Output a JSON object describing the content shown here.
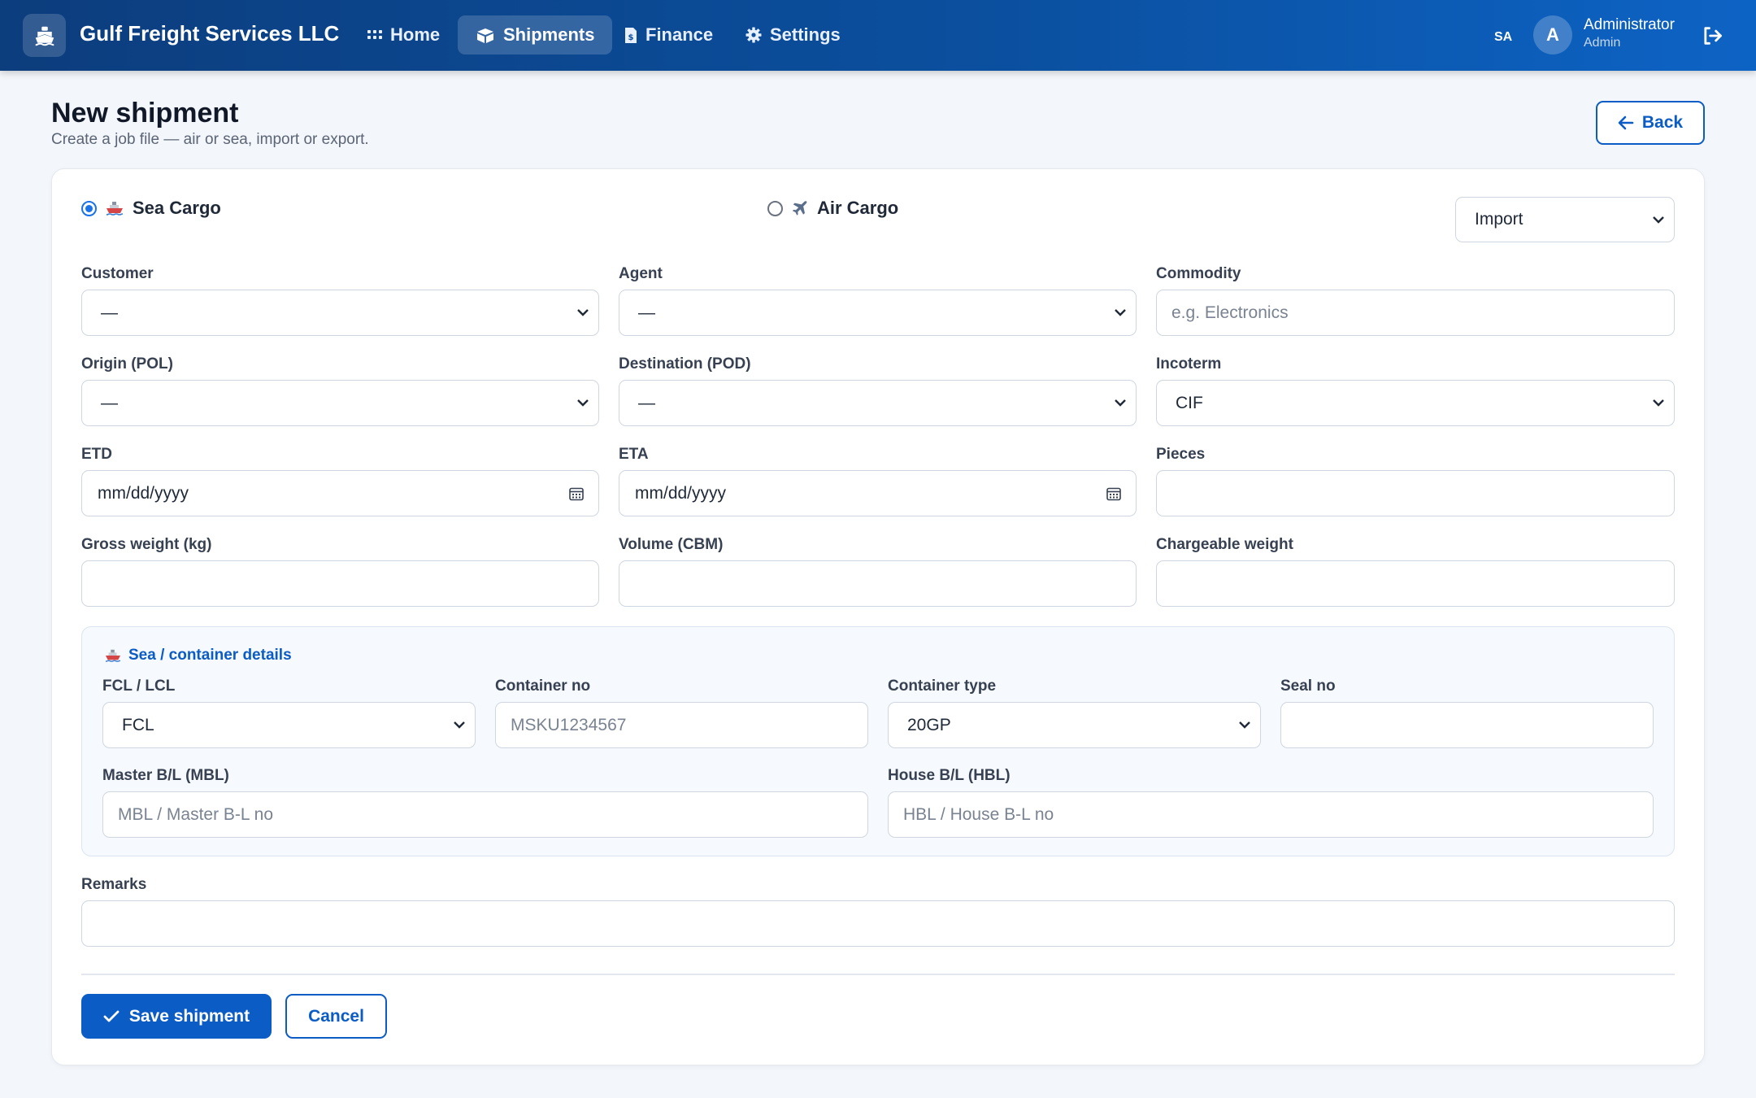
{
  "app": {
    "brand_name": "Gulf Freight Services LLC",
    "nav": [
      {
        "label": "Home",
        "icon": "grid-icon",
        "active": false
      },
      {
        "label": "Shipments",
        "icon": "box-icon",
        "active": true
      },
      {
        "label": "Finance",
        "icon": "invoice-icon",
        "active": false
      },
      {
        "label": "Settings",
        "icon": "gear-icon",
        "active": false
      }
    ],
    "language": "SA",
    "user": {
      "initial": "A",
      "name": "Administrator",
      "role": "Admin"
    }
  },
  "page": {
    "title": "New shipment",
    "subtitle": "Create a job file — air or sea, import or export.",
    "back_label": "Back"
  },
  "form": {
    "mode": {
      "sea_label": "Sea Cargo",
      "air_label": "Air Cargo",
      "selected": "Sea Cargo",
      "direction": "Import"
    },
    "customer": {
      "label": "Customer",
      "value": "—"
    },
    "agent": {
      "label": "Agent",
      "value": "—"
    },
    "commodity": {
      "label": "Commodity",
      "placeholder": "e.g. Electronics"
    },
    "origin": {
      "label": "Origin (POL)",
      "value": "—"
    },
    "destination": {
      "label": "Destination (POD)",
      "value": "—"
    },
    "incoterm": {
      "label": "Incoterm",
      "value": "CIF"
    },
    "etd": {
      "label": "ETD",
      "value": "mm/dd/yyyy"
    },
    "eta": {
      "label": "ETA",
      "value": "mm/dd/yyyy"
    },
    "pieces": {
      "label": "Pieces",
      "value": ""
    },
    "gross_weight": {
      "label": "Gross weight (kg)",
      "value": ""
    },
    "volume": {
      "label": "Volume (CBM)",
      "value": ""
    },
    "chargeable_weight": {
      "label": "Chargeable weight",
      "value": ""
    },
    "sea": {
      "title": "Sea / container details",
      "fcl_lcl": {
        "label": "FCL / LCL",
        "value": "FCL"
      },
      "container_no": {
        "label": "Container no",
        "placeholder": "MSKU1234567"
      },
      "container_type": {
        "label": "Container type",
        "value": "20GP"
      },
      "seal_no": {
        "label": "Seal no",
        "value": ""
      },
      "mbl": {
        "label": "Master B/L (MBL)",
        "placeholder": "MBL / Master B-L no"
      },
      "hbl": {
        "label": "House B/L (HBL)",
        "placeholder": "HBL / House B-L no"
      }
    },
    "remarks": {
      "label": "Remarks",
      "value": ""
    },
    "save_label": "Save shipment",
    "cancel_label": "Cancel"
  },
  "colors": {
    "primary": "#0b5cc4",
    "navbar_start": "#0c3d7d",
    "navbar_end": "#0d63c4",
    "page_bg": "#f3f6fa"
  }
}
